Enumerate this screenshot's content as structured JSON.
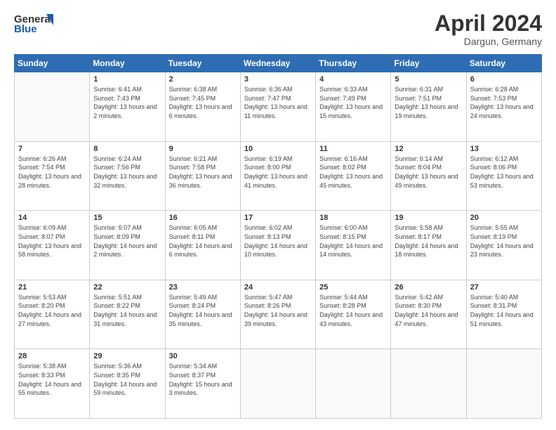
{
  "header": {
    "logo_line1": "General",
    "logo_line2": "Blue",
    "month_year": "April 2024",
    "location": "Dargun, Germany"
  },
  "weekdays": [
    "Sunday",
    "Monday",
    "Tuesday",
    "Wednesday",
    "Thursday",
    "Friday",
    "Saturday"
  ],
  "weeks": [
    [
      {
        "day": "",
        "sunrise": "",
        "sunset": "",
        "daylight": ""
      },
      {
        "day": "1",
        "sunrise": "Sunrise: 6:41 AM",
        "sunset": "Sunset: 7:43 PM",
        "daylight": "Daylight: 13 hours and 2 minutes."
      },
      {
        "day": "2",
        "sunrise": "Sunrise: 6:38 AM",
        "sunset": "Sunset: 7:45 PM",
        "daylight": "Daylight: 13 hours and 6 minutes."
      },
      {
        "day": "3",
        "sunrise": "Sunrise: 6:36 AM",
        "sunset": "Sunset: 7:47 PM",
        "daylight": "Daylight: 13 hours and 11 minutes."
      },
      {
        "day": "4",
        "sunrise": "Sunrise: 6:33 AM",
        "sunset": "Sunset: 7:49 PM",
        "daylight": "Daylight: 13 hours and 15 minutes."
      },
      {
        "day": "5",
        "sunrise": "Sunrise: 6:31 AM",
        "sunset": "Sunset: 7:51 PM",
        "daylight": "Daylight: 13 hours and 19 minutes."
      },
      {
        "day": "6",
        "sunrise": "Sunrise: 6:28 AM",
        "sunset": "Sunset: 7:53 PM",
        "daylight": "Daylight: 13 hours and 24 minutes."
      }
    ],
    [
      {
        "day": "7",
        "sunrise": "Sunrise: 6:26 AM",
        "sunset": "Sunset: 7:54 PM",
        "daylight": "Daylight: 13 hours and 28 minutes."
      },
      {
        "day": "8",
        "sunrise": "Sunrise: 6:24 AM",
        "sunset": "Sunset: 7:56 PM",
        "daylight": "Daylight: 13 hours and 32 minutes."
      },
      {
        "day": "9",
        "sunrise": "Sunrise: 6:21 AM",
        "sunset": "Sunset: 7:58 PM",
        "daylight": "Daylight: 13 hours and 36 minutes."
      },
      {
        "day": "10",
        "sunrise": "Sunrise: 6:19 AM",
        "sunset": "Sunset: 8:00 PM",
        "daylight": "Daylight: 13 hours and 41 minutes."
      },
      {
        "day": "11",
        "sunrise": "Sunrise: 6:16 AM",
        "sunset": "Sunset: 8:02 PM",
        "daylight": "Daylight: 13 hours and 45 minutes."
      },
      {
        "day": "12",
        "sunrise": "Sunrise: 6:14 AM",
        "sunset": "Sunset: 8:04 PM",
        "daylight": "Daylight: 13 hours and 49 minutes."
      },
      {
        "day": "13",
        "sunrise": "Sunrise: 6:12 AM",
        "sunset": "Sunset: 8:06 PM",
        "daylight": "Daylight: 13 hours and 53 minutes."
      }
    ],
    [
      {
        "day": "14",
        "sunrise": "Sunrise: 6:09 AM",
        "sunset": "Sunset: 8:07 PM",
        "daylight": "Daylight: 13 hours and 58 minutes."
      },
      {
        "day": "15",
        "sunrise": "Sunrise: 6:07 AM",
        "sunset": "Sunset: 8:09 PM",
        "daylight": "Daylight: 14 hours and 2 minutes."
      },
      {
        "day": "16",
        "sunrise": "Sunrise: 6:05 AM",
        "sunset": "Sunset: 8:11 PM",
        "daylight": "Daylight: 14 hours and 6 minutes."
      },
      {
        "day": "17",
        "sunrise": "Sunrise: 6:02 AM",
        "sunset": "Sunset: 8:13 PM",
        "daylight": "Daylight: 14 hours and 10 minutes."
      },
      {
        "day": "18",
        "sunrise": "Sunrise: 6:00 AM",
        "sunset": "Sunset: 8:15 PM",
        "daylight": "Daylight: 14 hours and 14 minutes."
      },
      {
        "day": "19",
        "sunrise": "Sunrise: 5:58 AM",
        "sunset": "Sunset: 8:17 PM",
        "daylight": "Daylight: 14 hours and 18 minutes."
      },
      {
        "day": "20",
        "sunrise": "Sunrise: 5:55 AM",
        "sunset": "Sunset: 8:19 PM",
        "daylight": "Daylight: 14 hours and 23 minutes."
      }
    ],
    [
      {
        "day": "21",
        "sunrise": "Sunrise: 5:53 AM",
        "sunset": "Sunset: 8:20 PM",
        "daylight": "Daylight: 14 hours and 27 minutes."
      },
      {
        "day": "22",
        "sunrise": "Sunrise: 5:51 AM",
        "sunset": "Sunset: 8:22 PM",
        "daylight": "Daylight: 14 hours and 31 minutes."
      },
      {
        "day": "23",
        "sunrise": "Sunrise: 5:49 AM",
        "sunset": "Sunset: 8:24 PM",
        "daylight": "Daylight: 14 hours and 35 minutes."
      },
      {
        "day": "24",
        "sunrise": "Sunrise: 5:47 AM",
        "sunset": "Sunset: 8:26 PM",
        "daylight": "Daylight: 14 hours and 39 minutes."
      },
      {
        "day": "25",
        "sunrise": "Sunrise: 5:44 AM",
        "sunset": "Sunset: 8:28 PM",
        "daylight": "Daylight: 14 hours and 43 minutes."
      },
      {
        "day": "26",
        "sunrise": "Sunrise: 5:42 AM",
        "sunset": "Sunset: 8:30 PM",
        "daylight": "Daylight: 14 hours and 47 minutes."
      },
      {
        "day": "27",
        "sunrise": "Sunrise: 5:40 AM",
        "sunset": "Sunset: 8:31 PM",
        "daylight": "Daylight: 14 hours and 51 minutes."
      }
    ],
    [
      {
        "day": "28",
        "sunrise": "Sunrise: 5:38 AM",
        "sunset": "Sunset: 8:33 PM",
        "daylight": "Daylight: 14 hours and 55 minutes."
      },
      {
        "day": "29",
        "sunrise": "Sunrise: 5:36 AM",
        "sunset": "Sunset: 8:35 PM",
        "daylight": "Daylight: 14 hours and 59 minutes."
      },
      {
        "day": "30",
        "sunrise": "Sunrise: 5:34 AM",
        "sunset": "Sunset: 8:37 PM",
        "daylight": "Daylight: 15 hours and 3 minutes."
      },
      {
        "day": "",
        "sunrise": "",
        "sunset": "",
        "daylight": ""
      },
      {
        "day": "",
        "sunrise": "",
        "sunset": "",
        "daylight": ""
      },
      {
        "day": "",
        "sunrise": "",
        "sunset": "",
        "daylight": ""
      },
      {
        "day": "",
        "sunrise": "",
        "sunset": "",
        "daylight": ""
      }
    ]
  ]
}
